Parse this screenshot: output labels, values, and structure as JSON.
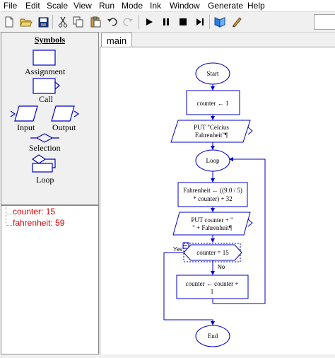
{
  "menu": [
    "File",
    "Edit",
    "Scale",
    "View",
    "Run",
    "Mode",
    "Ink",
    "Window",
    "Generate",
    "Help"
  ],
  "toolbar_icons": [
    "new-file-icon",
    "open-folder-icon",
    "save-icon",
    "cut-icon",
    "copy-icon",
    "paste-icon",
    "undo-icon",
    "redo-icon",
    "play-icon",
    "pause-icon",
    "stop-icon",
    "step-icon",
    "tutorial-icon",
    "ink-pen-icon"
  ],
  "symbols": {
    "title": "Symbols",
    "assignment": "Assignment",
    "call": "Call",
    "input": "Input",
    "output": "Output",
    "selection": "Selection",
    "loop": "Loop"
  },
  "variables": [
    {
      "name": "counter",
      "value": "15",
      "text": "counter: 15"
    },
    {
      "name": "fahrenheit",
      "value": "59",
      "text": "fahrenheit: 59"
    }
  ],
  "tabs": {
    "main": "main"
  },
  "flow": {
    "start": "Start",
    "assign1": "counter ← 1",
    "output1_line1": "PUT \"Celcius",
    "output1_line2": "Fahrenheit\"¶",
    "loop": "Loop",
    "assign2_line1": "Fahrenheit ← ((9.0 / 5)",
    "assign2_line2": "* counter) + 32",
    "output2_line1": "PUT counter + \"",
    "output2_line2": "\" + Fahrenheit¶",
    "yes": "Yes",
    "condition": "counter = 15",
    "no": "No",
    "assign3_line1": "counter ← counter +",
    "assign3_line2": "1",
    "end": "End"
  },
  "colors": {
    "flow_stroke": "#0000c8",
    "variable_text": "#e00000",
    "selection_dashed": "#0000c8"
  }
}
